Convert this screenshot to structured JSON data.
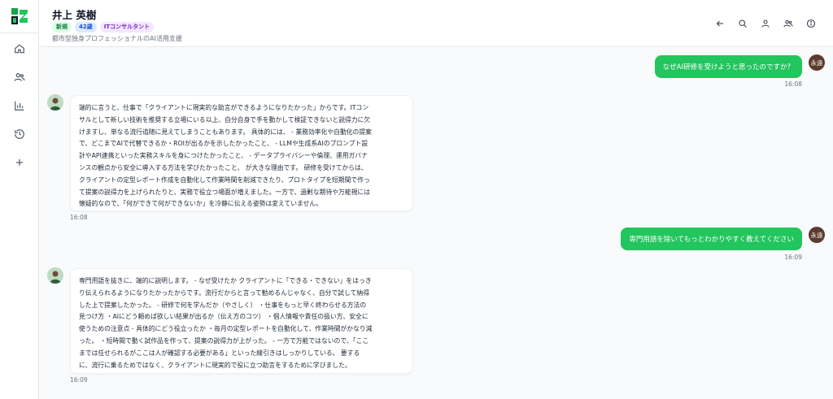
{
  "contact": {
    "name": "井上 英樹",
    "tags": [
      "新規",
      "42歳",
      "ITコンサルタント"
    ],
    "subtitle": "都市型独身プロフェッショナルのAI活用支援"
  },
  "sidebar": {
    "items": [
      "home-icon",
      "users-icon",
      "chart-icon",
      "history-icon",
      "plus-icon"
    ]
  },
  "header_actions": [
    "back-arrow-icon",
    "search-icon",
    "user-icon",
    "group-icon",
    "info-icon"
  ],
  "colors": {
    "user_bubble": "#22c55e",
    "user_avatar": "#5b3b2e"
  },
  "messages": [
    {
      "role": "user",
      "avatar": "永遠",
      "text": "なぜAI研修を受けようと思ったのですか？",
      "time": "16:08"
    },
    {
      "role": "ai",
      "lines": [
        "端的に言うと、仕事で「クライアントに現実的な助言ができるようになりたかった」からです。ITコン",
        "サルとして新しい技術を推奨する立場にいる以上、自分自身で手を動かして検証できないと説得力に欠",
        "けますし、単なる流行追随に見えてしまうこともあります。 具体的には、 - 業務効率化や自動化の提案",
        "で、どこまでAIで代替できるか・ROIが出るかを示したかったこと、 - LLMや生成系AIのプロンプト設",
        "計やAPI連携といった実務スキルを身につけたかったこと、 - データプライバシーや倫理、運用ガバナ",
        "ンスの観点から安全に導入する方法を学びたかったこと、 が大きな理由です。 研修を受けてからは、",
        "クライアントの定型レポート作成を自動化して作業時間を削減できたり、プロトタイプを短期間で作っ",
        "て提案の説得力を上げられたりと、実務で役立つ場面が増えました。一方で、過剰な期待や万能視には",
        "懐疑的なので、「何ができて何ができないか」を冷静に伝える姿勢は変えていません。"
      ],
      "time": "16:08"
    },
    {
      "role": "user",
      "avatar": "永遠",
      "text": "専門用語を除いてもっとわかりやすく教えてください",
      "time": "16:09"
    },
    {
      "role": "ai",
      "lines": [
        "専門用語を抜きに、端的に説明します。 - なぜ受けたか クライアントに「できる・できない」をはっき",
        "り伝えられるようになりたかったからです。流行だからと言って勧めるんじゃなく、自分で試して納得",
        "した上で提案したかった。 - 研修で何を学んだか（やさしく） ・仕事をもっと早く終わらせる方法の",
        "見つけ方 ・AIにどう頼めば欲しい結果が出るか（伝え方のコツ） ・個人情報や責任の扱い方、安全に",
        "使うための注意点 - 具体的にどう役立ったか ・毎月の定型レポートを自動化して、作業時間がかなり減",
        "った。 ・短時間で動く試作品を作って、提案の説得力が上がった。 - 一方で万能ではないので、「ここ",
        "までは任せられるがここは人が確認する必要がある」といった線引きはしっかりしている。 要する",
        "に、流行に乗るためではなく、クライアントに現実的で役に立つ助言をするために学びました。"
      ],
      "time": "16:09"
    }
  ]
}
